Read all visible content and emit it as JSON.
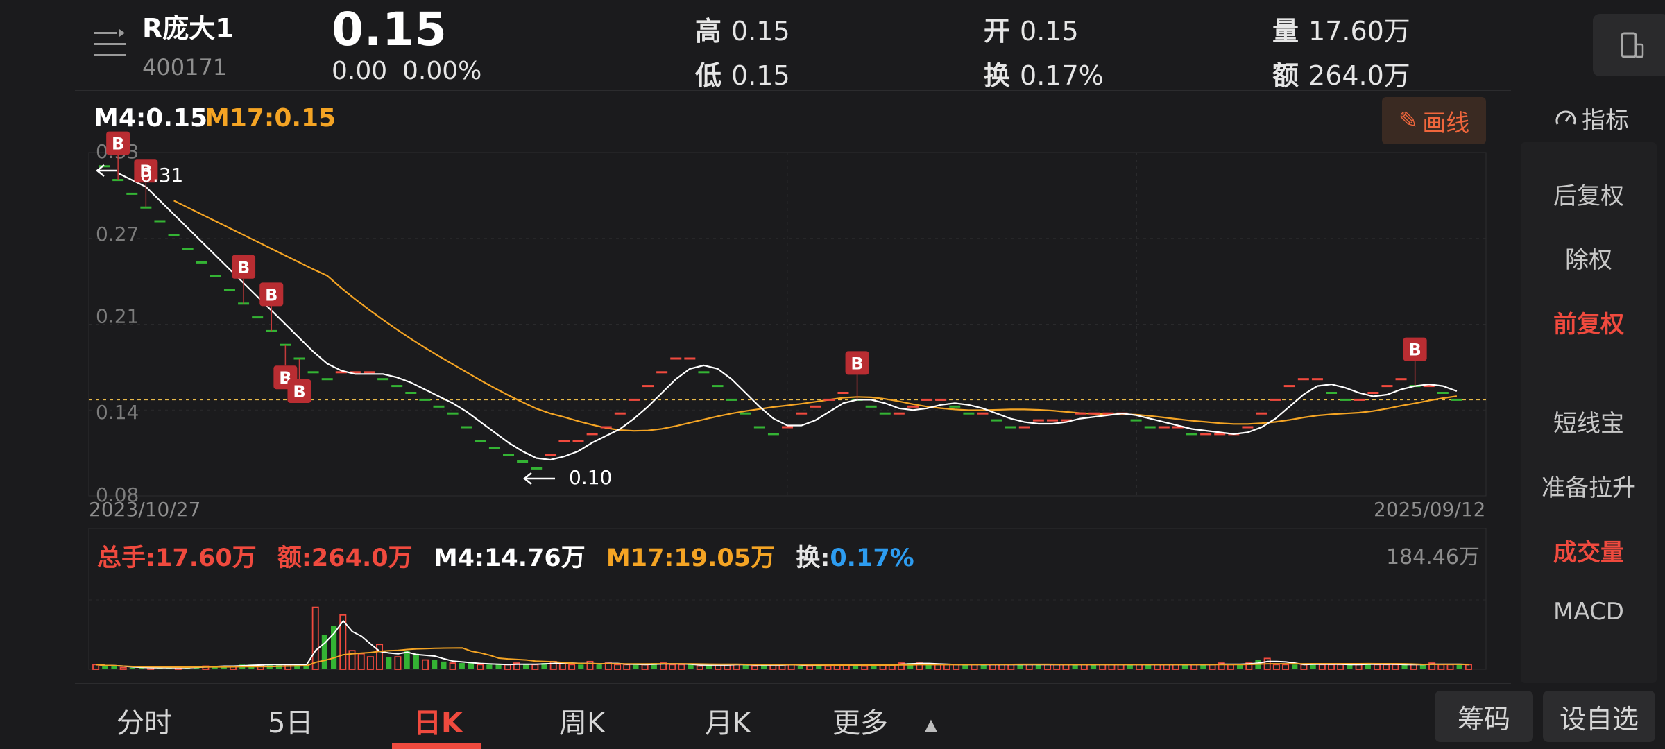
{
  "header": {
    "name": "R庞大1",
    "code": "400171",
    "price": "0.15",
    "change": "0.00",
    "change_pct": "0.00%",
    "stats": [
      {
        "key": "高",
        "value": "0.15"
      },
      {
        "key": "低",
        "value": "0.15"
      },
      {
        "key": "开",
        "value": "0.15"
      },
      {
        "key": "换",
        "value": "0.17%"
      },
      {
        "key": "量",
        "value": "17.60万"
      },
      {
        "key": "额",
        "value": "264.0万"
      }
    ]
  },
  "ma_legend": {
    "ma4": "M4:0.15",
    "ma17": "M17:0.15"
  },
  "draw_button": "画线",
  "indicator_label": "指标",
  "right_panel": [
    {
      "label": "后复权",
      "active": false
    },
    {
      "label": "除权",
      "active": false
    },
    {
      "label": "前复权",
      "active": true
    },
    {
      "label": "短线宝",
      "active": false
    },
    {
      "label": "准备拉升",
      "active": false
    },
    {
      "label": "成交量",
      "active": true
    },
    {
      "label": "MACD",
      "active": false
    }
  ],
  "volume_legend": {
    "total": "总手:17.60万",
    "amount": "额:264.0万",
    "ma4": "M4:14.76万",
    "ma17": "M17:19.05万",
    "turnover_label": "换:",
    "turnover_value": "0.17%",
    "max": "184.46万"
  },
  "tabs": [
    {
      "label": "分时",
      "active": false
    },
    {
      "label": "5日",
      "active": false
    },
    {
      "label": "日K",
      "active": true
    },
    {
      "label": "周K",
      "active": false
    },
    {
      "label": "月K",
      "active": false
    },
    {
      "label": "更多",
      "active": false
    }
  ],
  "bottom_buttons": [
    "筹码",
    "设自选"
  ],
  "colors": {
    "up": "#f04a3e",
    "down": "#34b334",
    "ma4": "#ffffff",
    "ma17": "#f4a424",
    "turnover": "#2d9cf0"
  },
  "chart_data": {
    "type": "candlestick",
    "x_start": "2023/10/27",
    "x_end": "2025/09/12",
    "y_ticks": [
      "0.33",
      "0.27",
      "0.21",
      "0.14",
      "0.08"
    ],
    "ylim": [
      0.08,
      0.33
    ],
    "max_label": "0.31",
    "min_label": "0.10",
    "last_close": 0.15,
    "signal_label": "B",
    "closes": [
      0.32,
      0.31,
      0.3,
      0.29,
      0.28,
      0.27,
      0.26,
      0.25,
      0.24,
      0.23,
      0.22,
      0.21,
      0.2,
      0.19,
      0.18,
      0.17,
      0.165,
      0.17,
      0.17,
      0.17,
      0.165,
      0.16,
      0.155,
      0.15,
      0.145,
      0.14,
      0.13,
      0.12,
      0.115,
      0.11,
      0.105,
      0.1,
      0.11,
      0.12,
      0.12,
      0.125,
      0.13,
      0.14,
      0.15,
      0.16,
      0.17,
      0.18,
      0.18,
      0.17,
      0.16,
      0.15,
      0.14,
      0.13,
      0.125,
      0.13,
      0.14,
      0.145,
      0.15,
      0.155,
      0.15,
      0.145,
      0.14,
      0.14,
      0.145,
      0.15,
      0.15,
      0.145,
      0.14,
      0.14,
      0.135,
      0.13,
      0.13,
      0.135,
      0.135,
      0.135,
      0.14,
      0.14,
      0.14,
      0.14,
      0.135,
      0.13,
      0.13,
      0.13,
      0.125,
      0.125,
      0.125,
      0.125,
      0.13,
      0.14,
      0.15,
      0.16,
      0.165,
      0.165,
      0.155,
      0.15,
      0.15,
      0.155,
      0.16,
      0.165,
      0.16,
      0.16,
      0.155,
      0.15
    ],
    "volumes": [
      3,
      2,
      2,
      1,
      1,
      1,
      1,
      1,
      1,
      1,
      1,
      2,
      2,
      2,
      2,
      2,
      3,
      3,
      3,
      3,
      3,
      3,
      3,
      3,
      40,
      22,
      28,
      35,
      12,
      10,
      8,
      16,
      8,
      8,
      12,
      10,
      6,
      6,
      5,
      4,
      4,
      4,
      3,
      3,
      3,
      3,
      4,
      3,
      3,
      4,
      5,
      4,
      3,
      3,
      5,
      3,
      4,
      3,
      3,
      3,
      3,
      4,
      4,
      3,
      3,
      3,
      2,
      3,
      3,
      3,
      3,
      3,
      2,
      3,
      3,
      3,
      3,
      2,
      2,
      3,
      2,
      3,
      3,
      3,
      2,
      3,
      3,
      3,
      4,
      4,
      4,
      3,
      3,
      3,
      3,
      3,
      3,
      3,
      3,
      3,
      3,
      3,
      3,
      3,
      3,
      3,
      3,
      3,
      3,
      3,
      3,
      3,
      3,
      3,
      3,
      3,
      3,
      3,
      3,
      3,
      3,
      3,
      3,
      4,
      3,
      3,
      4,
      6,
      7,
      3,
      3,
      3,
      3,
      4,
      3,
      3,
      3,
      3,
      3,
      4,
      3,
      3,
      3,
      3,
      3,
      3,
      4,
      3,
      3,
      3,
      3
    ]
  }
}
